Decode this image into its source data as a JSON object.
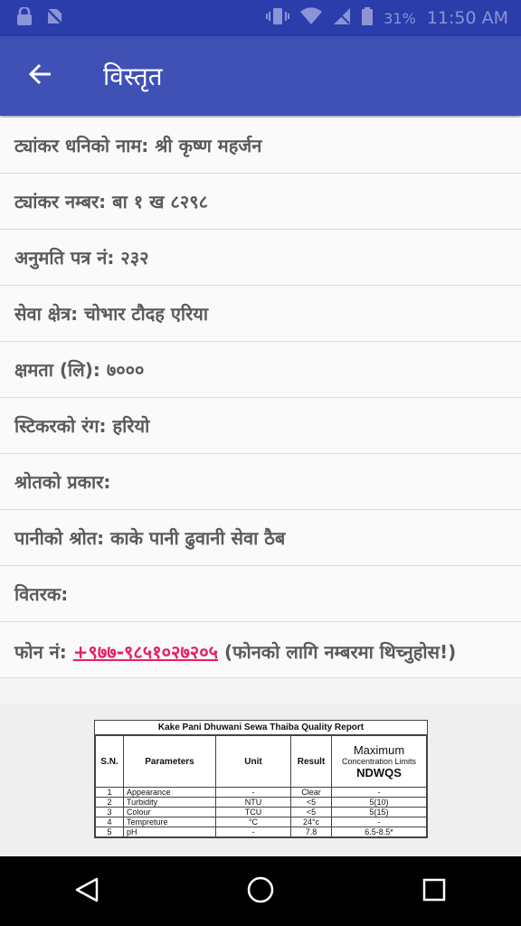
{
  "status_bar": {
    "battery": "31%",
    "time": "11:50 AM"
  },
  "app_bar": {
    "title": "विस्तृत"
  },
  "details": [
    "ट्यांकर धनिको नाम: श्री कृष्ण महर्जन",
    "ट्यांकर नम्बर: बा १ ख ८२९८",
    "अनुमति पत्र नं: २३२",
    "सेवा क्षेत्र: चोभार टौदह एरिया",
    "क्षमता (लि): ७०००",
    "स्टिकरको रंग: हरियो",
    "श्रोतको प्रकार:",
    "पानीको श्रोत: काके पानी ढुवानी सेवा ठैब",
    "वितरक:"
  ],
  "phone": {
    "label": "फोन नं: ",
    "number": "+९७७-९८५१०२७२०५",
    "note": " (फोनको लागि नम्बरमा थिच्नुहोस!)"
  },
  "report": {
    "title": "Kake Pani Dhuwani Sewa Thaiba Quality Report",
    "headers": {
      "sn": "S.N.",
      "param": "Parameters",
      "unit": "Unit",
      "result": "Result",
      "max": "Maximum",
      "conc": "Concentration Limits",
      "ndwqs": "NDWQS"
    },
    "rows": [
      {
        "sn": "1",
        "param": "Appearance",
        "unit": "-",
        "result": "Clear",
        "limit": "-"
      },
      {
        "sn": "2",
        "param": "Turbidity",
        "unit": "NTU",
        "result": "<5",
        "limit": "5(10)"
      },
      {
        "sn": "3",
        "param": "Colour",
        "unit": "TCU",
        "result": "<5",
        "limit": "5(15)"
      },
      {
        "sn": "4",
        "param": "Tempreture",
        "unit": "°C",
        "result": "24°c",
        "limit": "-"
      },
      {
        "sn": "5",
        "param": "pH",
        "unit": "-",
        "result": "7.8",
        "limit": "6.5-8.5*"
      }
    ]
  },
  "icons": [
    "lock-icon",
    "no-sim-icon",
    "vibrate-icon",
    "wifi-icon",
    "no-signal-icon",
    "battery-icon",
    "back-arrow-icon",
    "nav-back-icon",
    "nav-home-icon",
    "nav-recents-icon"
  ]
}
